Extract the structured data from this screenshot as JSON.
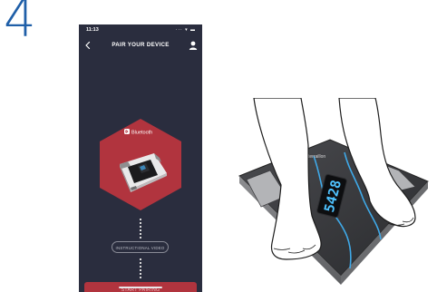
{
  "step": {
    "number": "4"
  },
  "phone": {
    "status_time": "11:13",
    "status_icons": "··· ▾ ▬",
    "nav_title": "PAIR YOUR DEVICE",
    "bluetooth_label": "Bluetooth",
    "video_button_label": "INSTRUCTIONAL VIDEO",
    "start_button_label": "START PAIRING",
    "icons": [
      "back-chevron-icon",
      "profile-icon",
      "bluetooth-icon"
    ],
    "colors": {
      "screen_bg": "#2a2d3e",
      "hex_accent": "#b1343e",
      "button_accent": "#b1343e"
    }
  },
  "scale": {
    "brand": "terraillon",
    "display_value": "5428",
    "display_color": "#4fc3ff"
  }
}
